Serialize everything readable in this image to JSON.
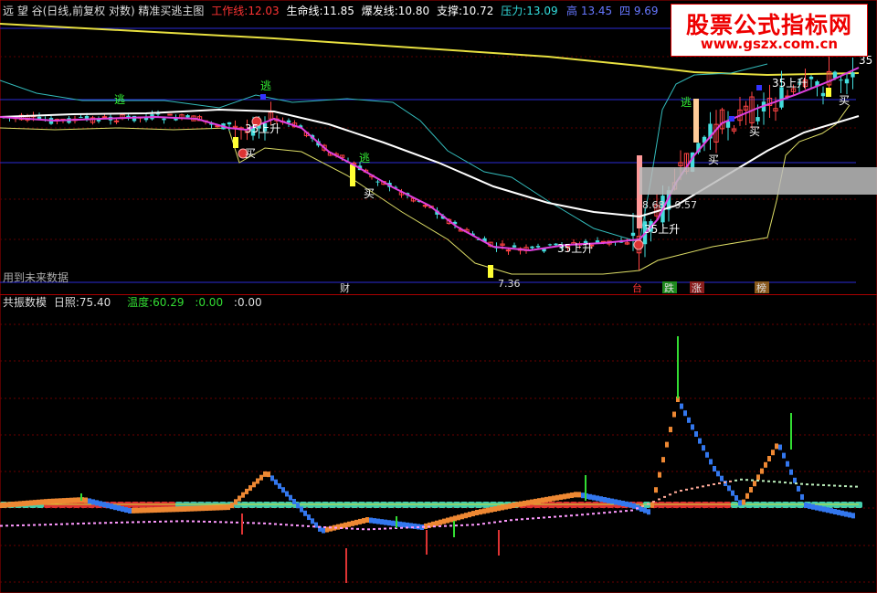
{
  "header": {
    "title": "远 望 谷(日线,前复权 对数) 精准买逃主图",
    "indicators": [
      {
        "label": "工作线:",
        "value": "12.03",
        "color": "#ff3333"
      },
      {
        "label": "生命线:",
        "value": "11.85",
        "color": "#ffffff"
      },
      {
        "label": "爆发线:",
        "value": "10.80",
        "color": "#ffffff"
      },
      {
        "label": "支撑:",
        "value": "10.72",
        "color": "#ffffff"
      },
      {
        "label": "压力:",
        "value": "13.09",
        "color": "#33dddd"
      }
    ],
    "right_partial": [
      {
        "text": "高 13.45",
        "color": "#6677ff"
      },
      {
        "text": "四 9.69",
        "color": "#6677ff"
      }
    ]
  },
  "watermark": {
    "line1": "股票公式指标网",
    "line2": "www.gszx.com.cn"
  },
  "future_note": "用到未来数据",
  "sub_header": {
    "title": "共振数模",
    "items": [
      {
        "label": "日照:",
        "value": "75.40",
        "color": "#dddddd"
      },
      {
        "label": "温度:",
        "value": "60.29",
        "color": "#33dd33"
      },
      {
        "label": ":",
        "value": "0.00",
        "color": "#33dd33"
      },
      {
        "label": ":",
        "value": "0.00",
        "color": "#dddddd"
      }
    ]
  },
  "chart_data": [
    {
      "type": "candlestick",
      "title": "远 望 谷(日线,前复权 对数) 精准买逃主图",
      "y_scale": "log",
      "price_labels": [
        {
          "text": "8.68 - 9.57",
          "color": "#dddddd"
        },
        {
          "text": "7.36",
          "color": "#dddddd"
        }
      ],
      "signals": [
        {
          "text": "逃",
          "color": "#33ee33"
        },
        {
          "text": "逃",
          "color": "#33ee33"
        },
        {
          "text": "逃",
          "color": "#33ee33"
        },
        {
          "text": "逃",
          "color": "#33ee33"
        },
        {
          "text": "买",
          "color": "#ffffff"
        },
        {
          "text": "买",
          "color": "#ffffff"
        },
        {
          "text": "买",
          "color": "#ffffff"
        },
        {
          "text": "买",
          "color": "#ffffff"
        },
        {
          "text": "买",
          "color": "#ffffff"
        },
        {
          "text": "35上升",
          "color": "#ffffff"
        },
        {
          "text": "35上升",
          "color": "#ffffff"
        },
        {
          "text": "35上升",
          "color": "#ffffff"
        },
        {
          "text": "35上升",
          "color": "#ffffff"
        },
        {
          "text": "35",
          "color": "#ffffff"
        }
      ],
      "bottom_tags": [
        {
          "text": "财",
          "color": "#dddddd"
        },
        {
          "text": "台",
          "color": "#ff3333"
        },
        {
          "text": "跌",
          "color": "#dddddd",
          "bg": "#1e8a1e"
        },
        {
          "text": "涨",
          "color": "#dddddd",
          "bg": "#8a1e1e"
        },
        {
          "text": "榜",
          "color": "#dddddd",
          "bg": "#8a5a1e"
        }
      ],
      "lines": [
        {
          "name": "工作线",
          "color": "#e040e0"
        },
        {
          "name": "生命线",
          "color": "#ffffff"
        },
        {
          "name": "压力",
          "color": "#33cccc"
        },
        {
          "name": "支撑",
          "color": "#dddd66"
        },
        {
          "name": "长期线",
          "color": "#e8e040"
        }
      ],
      "series": [
        {
          "name": "长期线",
          "values": [
            13.1,
            13.05,
            13.0,
            12.95,
            12.9,
            12.85,
            12.8,
            12.75,
            12.7,
            12.7,
            12.75,
            12.8
          ]
        },
        {
          "name": "生命线",
          "values": [
            10.5,
            10.6,
            10.5,
            10.3,
            9.9,
            9.4,
            9.0,
            8.7,
            8.6,
            8.9,
            9.6,
            11.5
          ]
        },
        {
          "name": "工作线",
          "values": [
            10.5,
            10.7,
            10.5,
            10.2,
            9.6,
            8.9,
            8.3,
            8.2,
            8.3,
            9.2,
            11.8,
            12.03
          ]
        }
      ]
    },
    {
      "type": "step-line",
      "title": "共振数模",
      "series": [
        {
          "name": "日照",
          "values": [
            0,
            2,
            3,
            -3,
            -2,
            -1,
            18,
            -14,
            -8,
            -12,
            -4,
            0,
            6,
            0,
            -4,
            58,
            20,
            0,
            34,
            0,
            -6
          ]
        },
        {
          "name": "温度",
          "values": [
            -5,
            -4,
            -3,
            -2,
            -1,
            -2,
            -3,
            -6,
            -8,
            -6,
            -4,
            0,
            4,
            8,
            14,
            24,
            30,
            34,
            32,
            30,
            28
          ]
        }
      ]
    }
  ]
}
